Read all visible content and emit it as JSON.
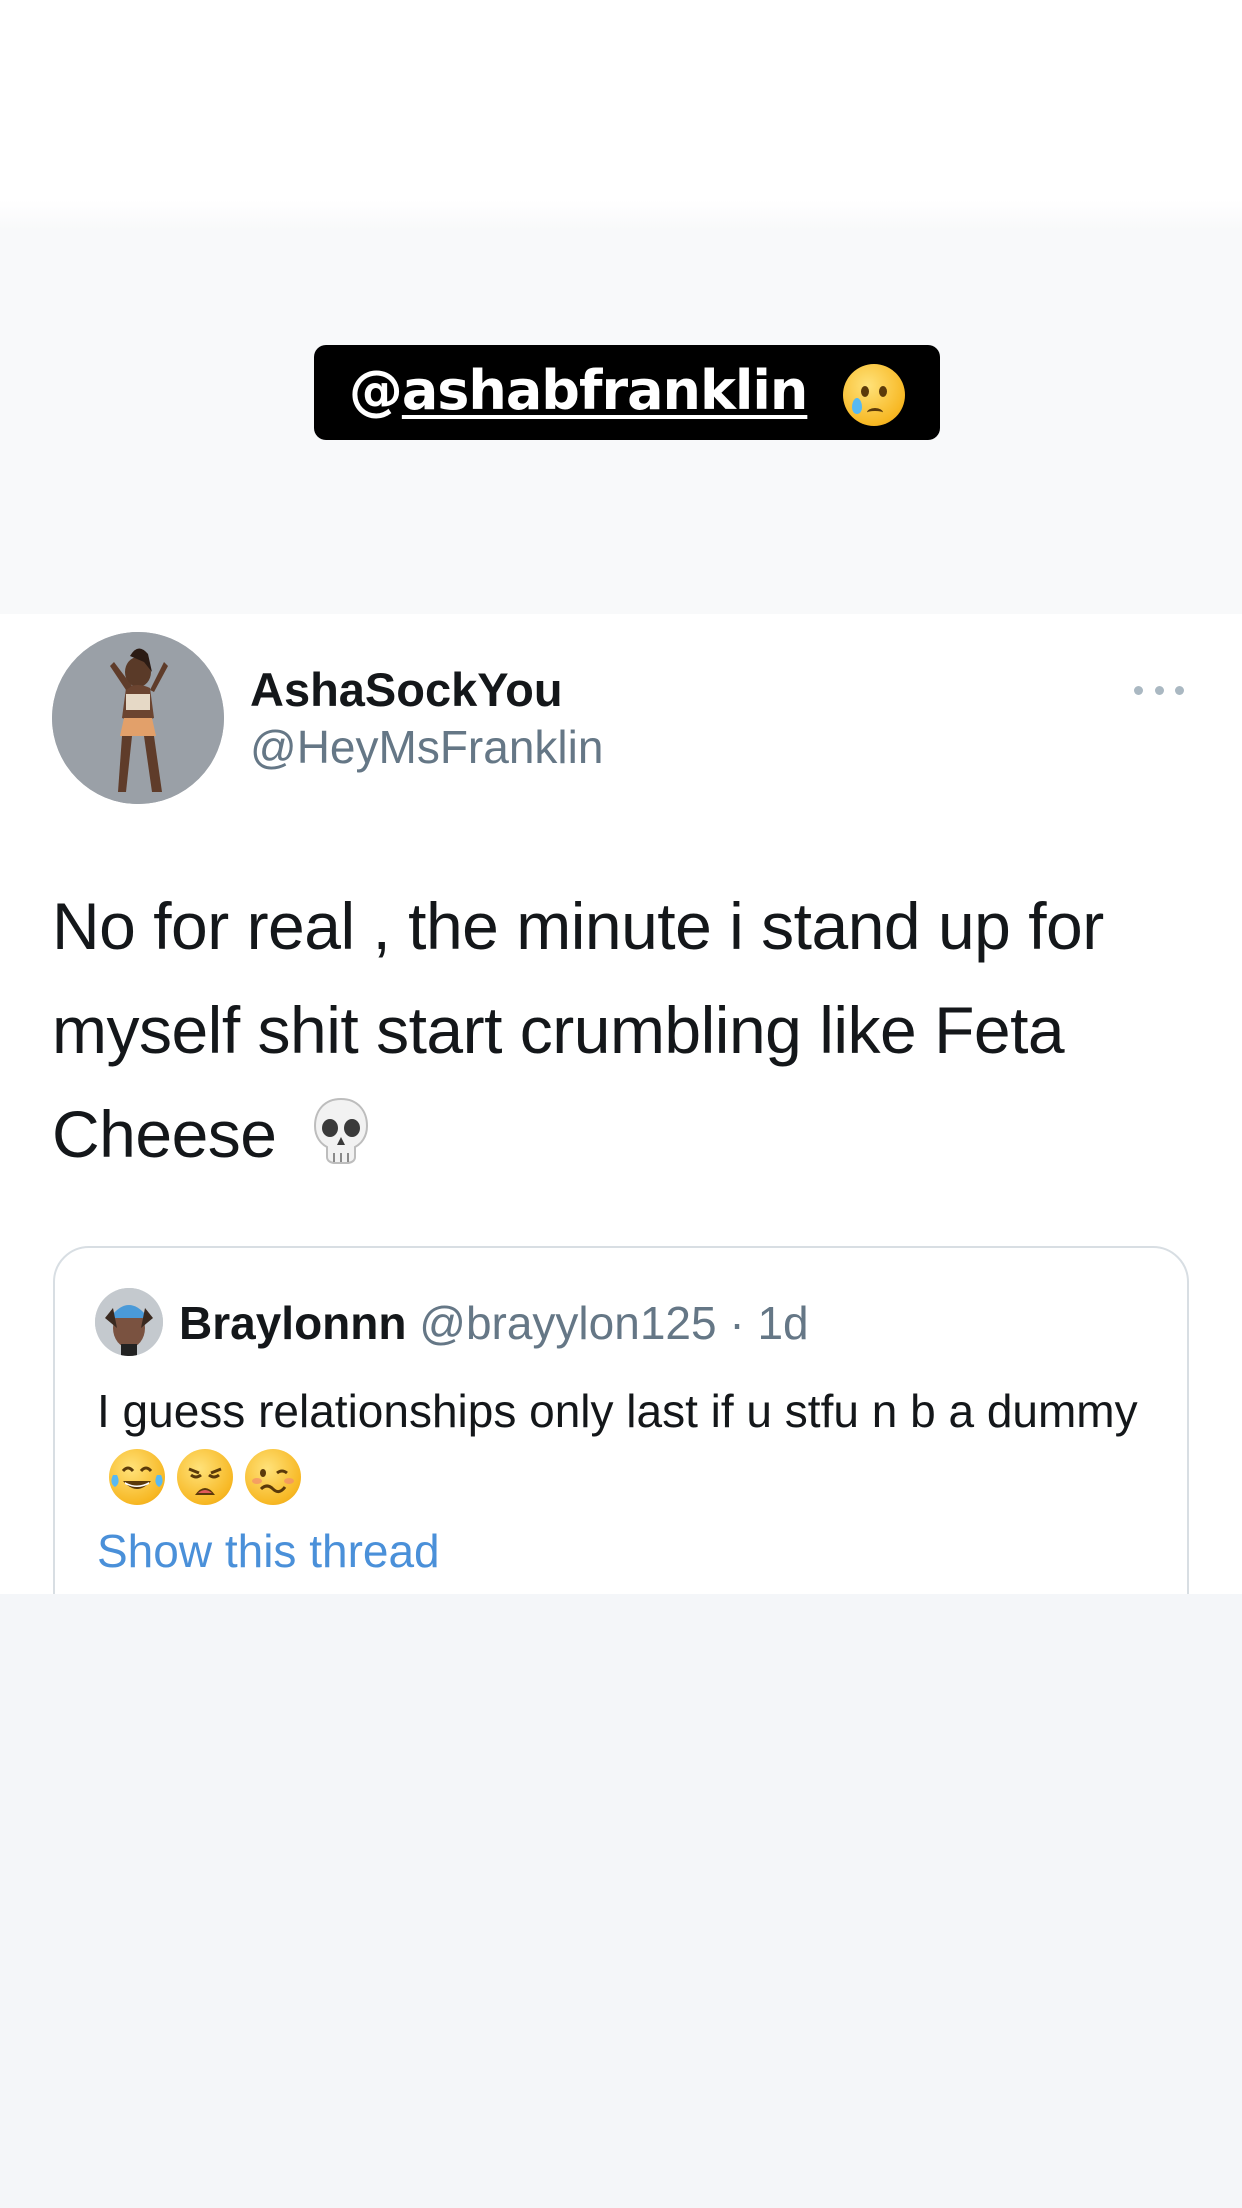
{
  "mention": {
    "at": "@",
    "handle": "ashabfranklin",
    "emoji": "face-holding-back-tears-icon"
  },
  "tweet": {
    "display_name": "AshaSockYou",
    "username": "@HeyMsFranklin",
    "text": "No for real , the minute i stand up for myself shit start crumbling like Feta Cheese",
    "emoji": "skull-icon"
  },
  "quote": {
    "name": "Braylonnn",
    "username": "@brayylon125",
    "separator": "·",
    "time": "1d",
    "text": "I guess relationships only last if u stfu n b a dummy",
    "emojis": [
      "tears-of-joy-icon",
      "weary-face-icon",
      "woozy-face-icon"
    ],
    "show_thread": "Show this thread"
  },
  "colors": {
    "link": "#4a90d9",
    "secondary_text": "#657786",
    "primary_text": "#14171a",
    "sticker_bg": "#000000"
  }
}
